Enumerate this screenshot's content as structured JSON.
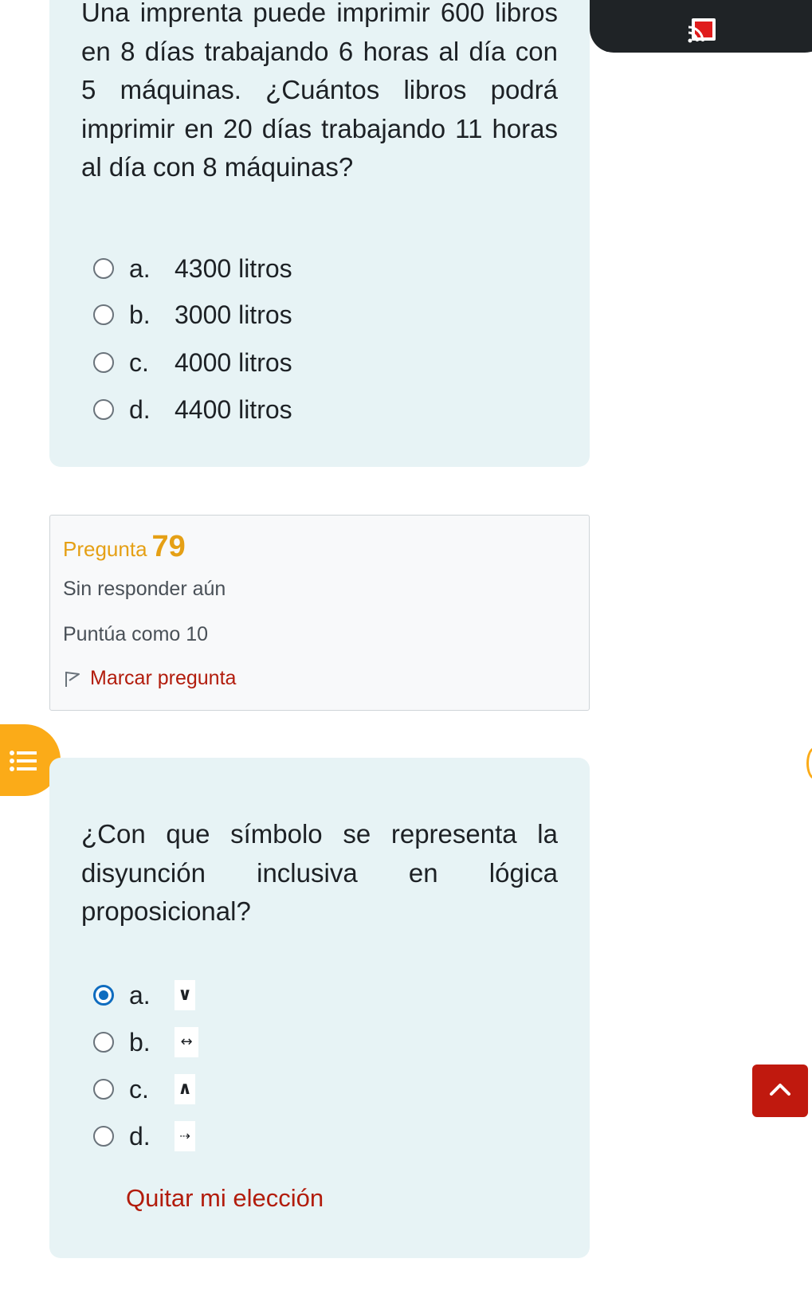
{
  "question_78": {
    "text": "Una imprenta puede imprimir 600 libros en 8 días trabajando 6 horas al día con 5 máquinas. ¿Cuántos libros podrá imprimir en 20 días trabajando 11 horas al día con 8 máquinas?",
    "options": [
      {
        "letter": "a.",
        "text": "4300 litros",
        "selected": false
      },
      {
        "letter": "b.",
        "text": "3000 litros",
        "selected": false
      },
      {
        "letter": "c.",
        "text": "4000 litros",
        "selected": false
      },
      {
        "letter": "d.",
        "text": "4400 litros",
        "selected": false
      }
    ]
  },
  "question_79": {
    "label": "Pregunta",
    "number": "79",
    "state": "Sin responder aún",
    "grade": "Puntúa como 10",
    "flag_label": "Marcar pregunta",
    "text": "¿Con que símbolo se representa la disyunción inclusiva en lógica proposicional?",
    "options": [
      {
        "letter": "a.",
        "symbol": "∨",
        "selected": true
      },
      {
        "letter": "b.",
        "symbol": "↔",
        "selected": false
      },
      {
        "letter": "c.",
        "symbol": "∧",
        "selected": false
      },
      {
        "letter": "d.",
        "symbol": "⇢",
        "selected": false
      }
    ],
    "clear_label": "Quitar mi elección"
  },
  "icons": {
    "cast": "cast-icon",
    "drawer": "list-icon",
    "back_to_top": "chevron-up-icon",
    "flag": "flag-icon"
  },
  "colors": {
    "accent_orange": "#fbab18",
    "link_red": "#b21c0c",
    "radio_blue": "#0f6cbf",
    "card_bg": "#e7f3f5"
  }
}
